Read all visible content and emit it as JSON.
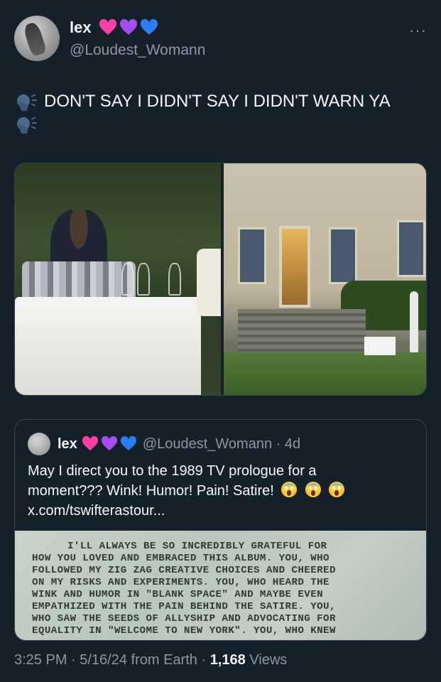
{
  "tweet": {
    "author": {
      "display_name": "lex",
      "handle": "@Loudest_Womann",
      "badges": [
        "pink-heart-icon",
        "purple-heart-icon",
        "blue-heart-icon"
      ]
    },
    "more_label": "···",
    "text_line1": "DON'T SAY I DIDN'T SAY I DIDN'T WARN YA",
    "emoji_icon": "speaking-head-icon",
    "media": [
      "photo-dinner-table",
      "photo-villa-staircase"
    ]
  },
  "quote": {
    "display_name": "lex",
    "handle_time": "@Loudest_Womann · 4d",
    "text_line1": "May I direct you to the 1989 TV prologue for a",
    "text_line2": "moment??? Wink! Humor! Pain! Satire!",
    "text_line3": "x.com/tswifterastour...",
    "emoji_icon": "screaming-face-icon",
    "image_text": [
      "I'LL ALWAYS BE SO INCREDIBLY GRATEFUL FOR",
      "HOW YOU LOVED AND EMBRACED THIS ALBUM. YOU, WHO",
      "FOLLOWED MY ZIG ZAG CREATIVE CHOICES AND CHEERED",
      "ON MY RISKS AND EXPERIMENTS. YOU, WHO HEARD THE",
      "WINK AND HUMOR IN \"BLANK SPACE\" AND MAYBE EVEN",
      "EMPATHIZED WITH THE PAIN BEHIND THE SATIRE. YOU,",
      "WHO SAW THE SEEDS OF ALLYSHIP AND ADVOCATING FOR",
      "EQUALITY IN \"WELCOME TO NEW YORK\". YOU, WHO KNEW"
    ]
  },
  "footer": {
    "meta": "3:25 PM · 5/16/24 from Earth · ",
    "views_count": "1,168",
    "views_label": " Views"
  },
  "colors": {
    "background": "#15202b",
    "text": "#f7f9f9",
    "secondary": "#8b98a5",
    "border": "#38444d"
  }
}
